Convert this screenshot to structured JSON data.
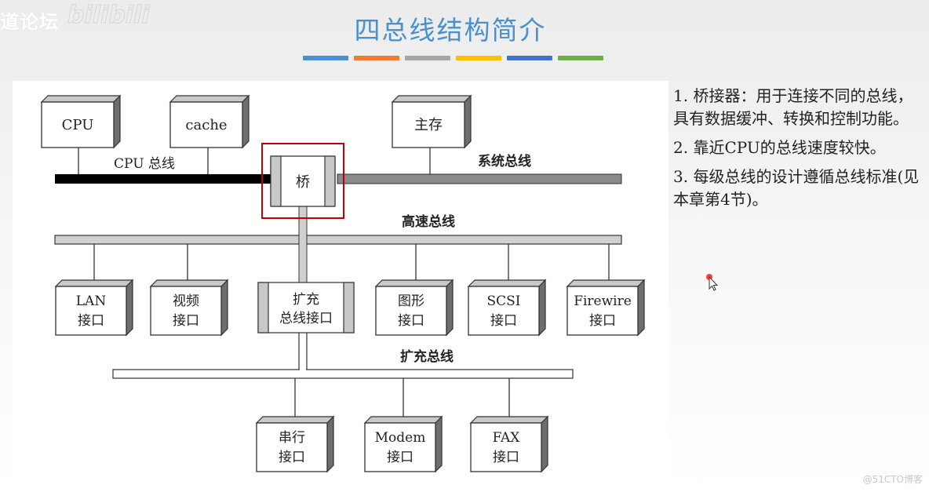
{
  "watermark_top_left": "道论坛",
  "watermark_logo": "bilibili",
  "title": "四总线结构简介",
  "title_bar_colors": [
    "#4a8fd2",
    "#ed7d31",
    "#a5a5a5",
    "#ffc000",
    "#4472c4",
    "#70ad47"
  ],
  "diagram": {
    "cpu": "CPU",
    "cache": "cache",
    "main_memory": "主存",
    "bridge": "桥",
    "cpu_bus_label": "CPU 总线",
    "system_bus_label": "系统总线",
    "high_speed_bus_label": "高速总线",
    "expansion_bus_label": "扩充总线",
    "highlight_color": "#c00000",
    "high_speed_devices": [
      {
        "line1": "LAN",
        "line2": "接口"
      },
      {
        "line1": "视频",
        "line2": "接口"
      },
      {
        "line1": "扩充",
        "line2": "总线接口"
      },
      {
        "line1": "图形",
        "line2": "接口"
      },
      {
        "line1": "SCSI",
        "line2": "接口"
      },
      {
        "line1": "Firewire",
        "line2": "接口"
      }
    ],
    "expansion_devices": [
      {
        "line1": "串行",
        "line2": "接口"
      },
      {
        "line1": "Modem",
        "line2": "接口"
      },
      {
        "line1": "FAX",
        "line2": "接口"
      }
    ]
  },
  "notes": [
    "1. 桥接器：用于连接不同的总线，具有数据缓冲、转换和控制功能。",
    "2. 靠近CPU的总线速度较快。",
    "3. 每级总线的设计遵循总线标准(见本章第4节)。"
  ],
  "watermark_bottom_right": "@51CTO博客"
}
